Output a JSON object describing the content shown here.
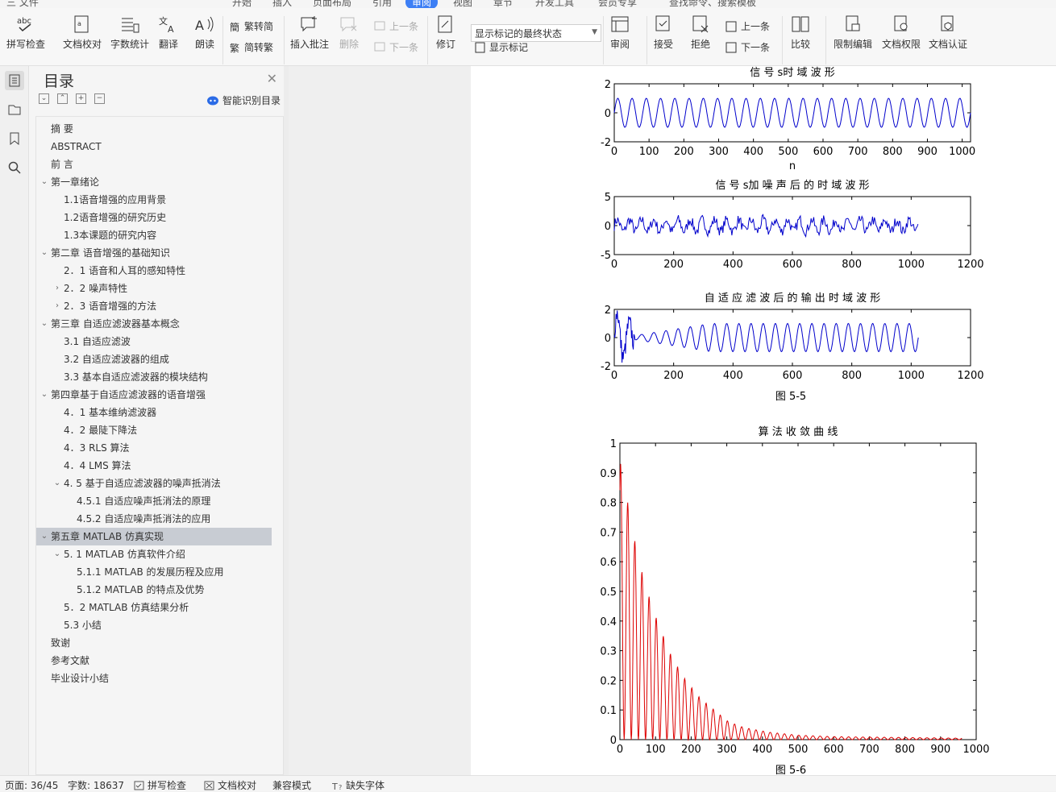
{
  "menubar": {
    "items": [
      "三 文件",
      "开始",
      "插入",
      "页面布局",
      "引用",
      "审阅",
      "视图",
      "章节",
      "开发工具",
      "会员专享",
      "查找命令、搜索模板"
    ],
    "active_index": 5
  },
  "ribbon": {
    "spell_check": "拼写检查",
    "doc_proof": "文档校对",
    "word_count": "字数统计",
    "translate": "翻译",
    "read_aloud": "朗读",
    "trad_to_simp": "繁转简",
    "simp_to_trad": "简转繁",
    "insert_comment": "插入批注",
    "delete": "删除",
    "prev_item": "上一条",
    "next_item": "下一条",
    "revise": "修订",
    "display_markup_state": "显示标记的最终状态",
    "show_markup": "显示标记",
    "review": "审阅",
    "accept": "接受",
    "reject": "拒绝",
    "prev_change": "上一条",
    "next_change": "下一条",
    "compare": "比较",
    "restrict_edit": "限制编辑",
    "doc_permission": "文档权限",
    "doc_certify": "文档认证"
  },
  "toc": {
    "title": "目录",
    "smart_label": "智能识别目录",
    "items": [
      {
        "text": "摘  要",
        "level": 0,
        "toggle": ""
      },
      {
        "text": "ABSTRACT",
        "level": 0,
        "toggle": ""
      },
      {
        "text": "前  言",
        "level": 0,
        "toggle": ""
      },
      {
        "text": "第一章绪论",
        "level": 0,
        "toggle": "v"
      },
      {
        "text": "1.1语音增强的应用背景",
        "level": 1,
        "toggle": ""
      },
      {
        "text": "1.2语音增强的研究历史",
        "level": 1,
        "toggle": ""
      },
      {
        "text": "1.3本课题的研究内容",
        "level": 1,
        "toggle": ""
      },
      {
        "text": "第二章  语音增强的基础知识",
        "level": 0,
        "toggle": "v"
      },
      {
        "text": "2．1 语音和人耳的感知特性",
        "level": 1,
        "toggle": ""
      },
      {
        "text": "2．2 噪声特性",
        "level": 1,
        "toggle": ">"
      },
      {
        "text": "2．3    语音增强的方法",
        "level": 1,
        "toggle": ">"
      },
      {
        "text": "第三章    自适应滤波器基本概念",
        "level": 0,
        "toggle": "v"
      },
      {
        "text": "3.1 自适应滤波",
        "level": 1,
        "toggle": ""
      },
      {
        "text": "3.2 自适应滤波器的组成",
        "level": 1,
        "toggle": ""
      },
      {
        "text": "3.3 基本自适应滤波器的模块结构",
        "level": 1,
        "toggle": ""
      },
      {
        "text": "第四章基于自适应滤波器的语音增强",
        "level": 0,
        "toggle": "v"
      },
      {
        "text": "4．1      基本维纳滤波器",
        "level": 1,
        "toggle": ""
      },
      {
        "text": "4．2 最陡下降法",
        "level": 1,
        "toggle": ""
      },
      {
        "text": "4．3    RLS 算法",
        "level": 1,
        "toggle": ""
      },
      {
        "text": "4．4    LMS 算法",
        "level": 1,
        "toggle": ""
      },
      {
        "text": "4. 5  基于自适应滤波器的噪声抵消法",
        "level": 1,
        "toggle": "v"
      },
      {
        "text": "4.5.1 自适应噪声抵消法的原理",
        "level": 2,
        "toggle": ""
      },
      {
        "text": "4.5.2 自适应噪声抵消法的应用",
        "level": 2,
        "toggle": ""
      },
      {
        "text": "第五章  MATLAB 仿真实现",
        "level": 0,
        "toggle": "v",
        "selected": true
      },
      {
        "text": "5. 1 MATLAB 仿真软件介绍",
        "level": 1,
        "toggle": "v"
      },
      {
        "text": "5.1.1 MATLAB 的发展历程及应用",
        "level": 2,
        "toggle": ""
      },
      {
        "text": "5.1.2    MATLAB 的特点及优势",
        "level": 2,
        "toggle": ""
      },
      {
        "text": "5．2    MATLAB 仿真结果分析",
        "level": 1,
        "toggle": ""
      },
      {
        "text": "5.3 小结",
        "level": 1,
        "toggle": ""
      },
      {
        "text": "致谢",
        "level": 0,
        "toggle": ""
      },
      {
        "text": "参考文献",
        "level": 0,
        "toggle": ""
      },
      {
        "text": "毕业设计小结",
        "level": 0,
        "toggle": ""
      }
    ]
  },
  "document": {
    "fig1_caption": "图 5-5",
    "fig2_caption": "图 5-6"
  },
  "chart_data": [
    {
      "type": "line",
      "title": "信 号 s时 域 波 形",
      "xlabel": "n",
      "ylabel": "",
      "xlim": [
        0,
        1024
      ],
      "ylim": [
        -2,
        2
      ],
      "xticks": [
        0,
        100,
        200,
        300,
        400,
        500,
        600,
        700,
        800,
        900,
        1000
      ],
      "yticks": [
        -2,
        0,
        2
      ],
      "color": "#0000cc",
      "series": [
        {
          "signal": "sinusoid",
          "amplitude": 1,
          "cycles": 25,
          "n_end": 1024
        }
      ]
    },
    {
      "type": "line",
      "title": "信 号 s加 噪 声 后 的 时 域 波 形",
      "xlabel": "",
      "ylabel": "",
      "xlim": [
        0,
        1200
      ],
      "ylim": [
        -5,
        5
      ],
      "xticks": [
        0,
        200,
        400,
        600,
        800,
        1000,
        1200
      ],
      "yticks": [
        -5,
        0,
        5
      ],
      "color": "#0000cc",
      "series": [
        {
          "signal": "noisy sinusoid",
          "amplitude": 1,
          "cycles": 25,
          "n_end": 1024
        }
      ]
    },
    {
      "type": "line",
      "title": "自 适 应 滤 波 后 的 输 出 时 域 波 形",
      "xlabel": "",
      "ylabel": "",
      "xlim": [
        0,
        1200
      ],
      "ylim": [
        -2,
        2
      ],
      "xticks": [
        0,
        200,
        400,
        600,
        800,
        1000,
        1200
      ],
      "yticks": [
        -2,
        0,
        2
      ],
      "color": "#0000cc",
      "series": [
        {
          "signal": "adaptive filter output converging to sinusoid",
          "amplitude": 1,
          "cycles": 25,
          "n_end": 1024
        }
      ]
    },
    {
      "type": "line",
      "title": "算 法 收 敛 曲 线",
      "xlabel": "",
      "ylabel": "",
      "xlim": [
        0,
        1000
      ],
      "ylim": [
        0,
        1
      ],
      "xticks": [
        0,
        100,
        200,
        300,
        400,
        500,
        600,
        700,
        800,
        900,
        1000
      ],
      "yticks": [
        0,
        0.1,
        0.2,
        0.3,
        0.4,
        0.5,
        0.6,
        0.7,
        0.8,
        0.9,
        1
      ],
      "color": "#dd0000",
      "series": [
        {
          "signal": "decaying oscillating error",
          "peaks": [
            [
              2,
              0.93
            ],
            [
              25,
              0.78
            ],
            [
              45,
              0.65
            ],
            [
              65,
              0.55
            ],
            [
              85,
              0.47
            ],
            [
              105,
              0.4
            ],
            [
              125,
              0.34
            ],
            [
              145,
              0.28
            ],
            [
              165,
              0.24
            ],
            [
              185,
              0.2
            ],
            [
              205,
              0.17
            ],
            [
              225,
              0.14
            ],
            [
              245,
              0.12
            ],
            [
              265,
              0.1
            ],
            [
              285,
              0.08
            ],
            [
              305,
              0.06
            ],
            [
              350,
              0.04
            ],
            [
              420,
              0.025
            ],
            [
              500,
              0.015
            ],
            [
              600,
              0.01
            ],
            [
              960,
              0.005
            ]
          ]
        }
      ]
    }
  ],
  "status": {
    "page": "页面: 36/45",
    "words": "字数: 18637",
    "spell": "拼写检查",
    "proof": "文档校对",
    "compat": "兼容模式",
    "missing_font": "缺失字体"
  }
}
